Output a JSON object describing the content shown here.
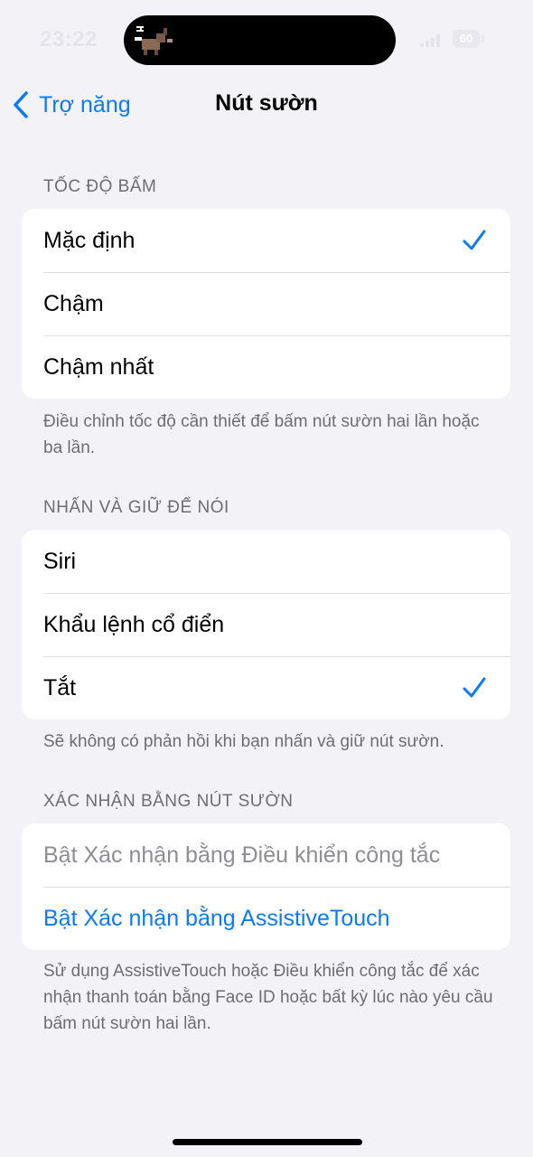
{
  "status_bar": {
    "time": "23:22",
    "battery": "60"
  },
  "nav": {
    "back_label": "Trợ năng",
    "title": "Nút sườn"
  },
  "sections": [
    {
      "header": "TỐC ĐỘ BẤM",
      "items": [
        {
          "label": "Mặc định",
          "checked": true
        },
        {
          "label": "Chậm",
          "checked": false
        },
        {
          "label": "Chậm nhất",
          "checked": false
        }
      ],
      "footer": "Điều chỉnh tốc độ cần thiết để bấm nút sườn hai lần hoặc ba lần."
    },
    {
      "header": "NHẤN VÀ GIỮ ĐỂ NÓI",
      "items": [
        {
          "label": "Siri",
          "checked": false
        },
        {
          "label": "Khẩu lệnh cổ điển",
          "checked": false
        },
        {
          "label": "Tắt",
          "checked": true
        }
      ],
      "footer": "Sẽ không có phản hồi khi bạn nhấn và giữ nút sườn."
    },
    {
      "header": "XÁC NHẬN BẰNG NÚT SƯỜN",
      "items": [
        {
          "label": "Bật Xác nhận bằng Điều khiển công tắc",
          "style": "disabled"
        },
        {
          "label": "Bật Xác nhận bằng AssistiveTouch",
          "style": "link"
        }
      ],
      "footer": "Sử dụng AssistiveTouch hoặc Điều khiển công tắc để xác nhận thanh toán bằng Face ID hoặc bất kỳ lúc nào yêu cầu bấm nút sườn hai lần."
    }
  ],
  "colors": {
    "accent": "#0a7aff",
    "background": "#f2f2f7",
    "secondary_text": "#6d6d72"
  }
}
